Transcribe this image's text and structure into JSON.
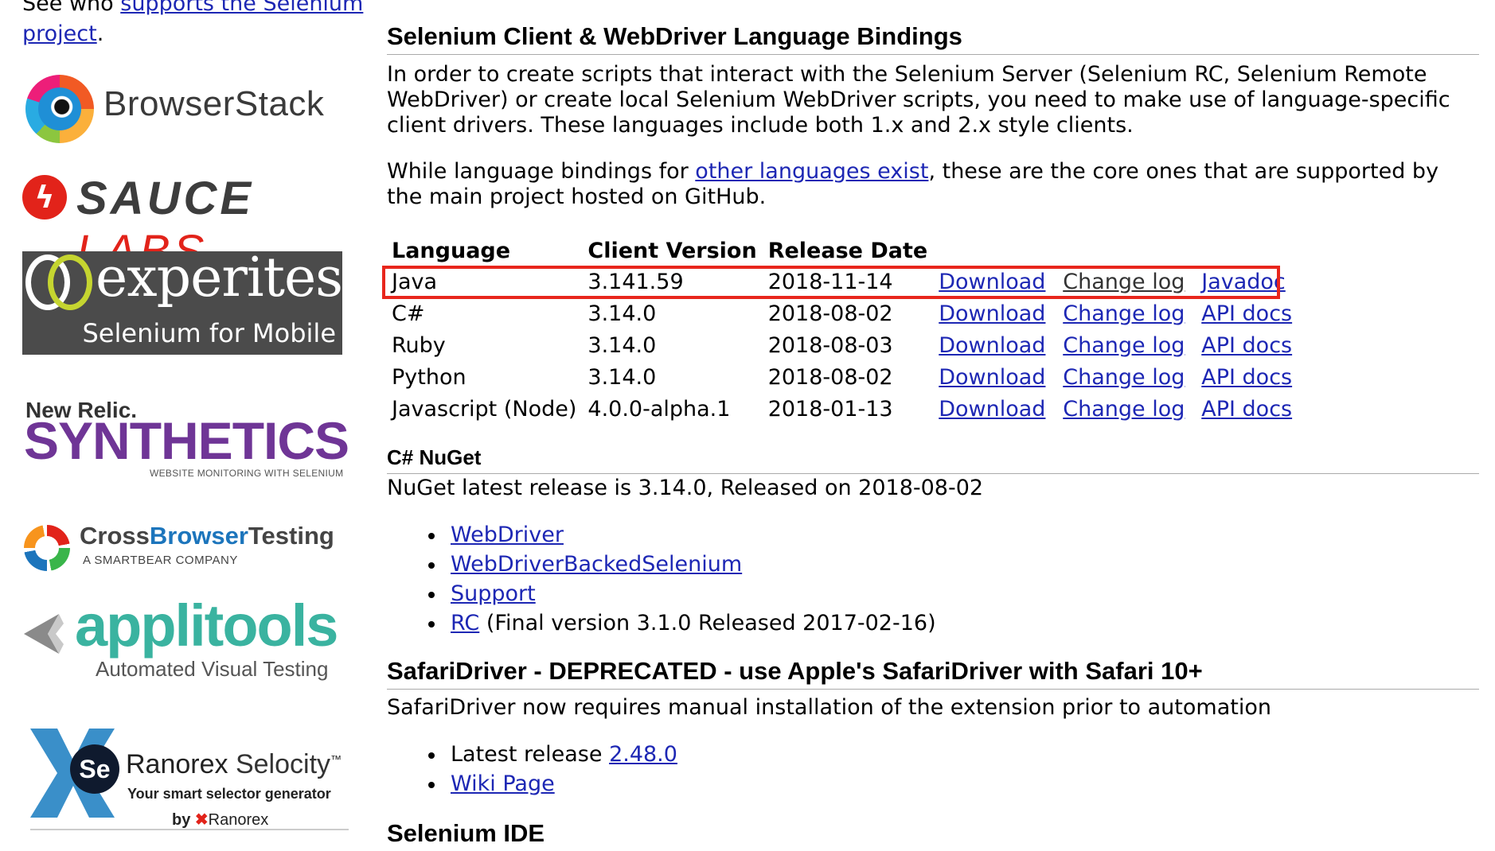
{
  "sidebar": {
    "intro_prefix": "See who ",
    "intro_link": "supports the Selenium project",
    "intro_suffix": ".",
    "sponsors": {
      "browserstack": {
        "text": "BrowserStack"
      },
      "saucelabs": {
        "sauce": "SAUCE",
        "labs": "LABS"
      },
      "experitest": {
        "title": "experitest",
        "tagline": "Selenium for Mobile"
      },
      "newrelic": {
        "brand": "New Relic.",
        "product": "SYNTHETICS",
        "tagline": "WEBSITE MONITORING WITH SELENIUM"
      },
      "crossbrowsertesting": {
        "cross": "Cross",
        "browser": "Browser",
        "testing": "Testing",
        "tagline": "A SMARTBEAR COMPANY"
      },
      "applitools": {
        "title": "applitools",
        "tagline": "Automated Visual Testing"
      },
      "ranorex": {
        "badge": "Se",
        "title_a": "Ranorex",
        "title_b": " Selocity",
        "tm": "™",
        "tagline": "Your smart selector generator",
        "by": "by",
        "company": "Ranorex"
      }
    }
  },
  "main": {
    "bindings_heading": "Selenium Client & WebDriver Language Bindings",
    "bindings_intro": "In order to create scripts that interact with the Selenium Server (Selenium RC, Selenium Remote WebDriver) or create local Selenium WebDriver scripts, you need to make use of language-specific client drivers. These languages include both 1.x and 2.x style clients.",
    "bindings_p2_prefix": "While language bindings for ",
    "bindings_p2_link": "other languages exist",
    "bindings_p2_suffix": ", these are the core ones that are supported by the main project hosted on GitHub.",
    "table": {
      "headers": [
        "Language",
        "Client Version",
        "Release Date"
      ],
      "rows": [
        {
          "language": "Java",
          "version": "3.141.59",
          "date": "2018-11-14",
          "download": "Download",
          "changelog": "Change log",
          "docs": "Javadoc"
        },
        {
          "language": "C#",
          "version": "3.14.0",
          "date": "2018-08-02",
          "download": "Download",
          "changelog": "Change log",
          "docs": "API docs"
        },
        {
          "language": "Ruby",
          "version": "3.14.0",
          "date": "2018-08-03",
          "download": "Download",
          "changelog": "Change log",
          "docs": "API docs"
        },
        {
          "language": "Python",
          "version": "3.14.0",
          "date": "2018-08-02",
          "download": "Download",
          "changelog": "Change log",
          "docs": "API docs"
        },
        {
          "language": "Javascript (Node)",
          "version": "4.0.0-alpha.1",
          "date": "2018-01-13",
          "download": "Download",
          "changelog": "Change log",
          "docs": "API docs"
        }
      ]
    },
    "nuget_heading": "C# NuGet",
    "nuget_text": "NuGet latest release is 3.14.0, Released on 2018-08-02",
    "nuget_links": {
      "webdriver": "WebDriver",
      "backed": "WebDriverBackedSelenium",
      "support": "Support",
      "rc": "RC",
      "rc_note": " (Final version 3.1.0 Released 2017-02-16)"
    },
    "safari_heading": "SafariDriver - DEPRECATED - use Apple's SafariDriver with Safari 10+",
    "safari_text": "SafariDriver now requires manual installation of the extension prior to automation",
    "safari_list": {
      "latest_prefix": "Latest release ",
      "latest_link": "2.48.0",
      "wiki": "Wiki Page"
    },
    "ide_heading": "Selenium IDE"
  },
  "colors": {
    "link": "#1d27b4",
    "highlight_border": "#e8261c",
    "saucelabs_red": "#e2231a",
    "newrelic_purple": "#6f3596",
    "applitools_teal": "#3ab3a0",
    "experitest_bg": "#4b4b4b"
  }
}
